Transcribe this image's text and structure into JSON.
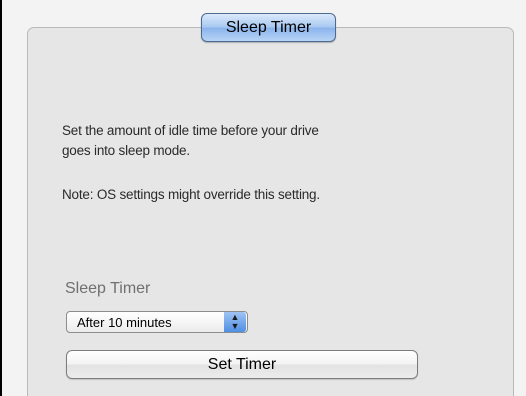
{
  "tab": {
    "label": "Sleep Timer"
  },
  "description": {
    "line1": "Set the amount of idle time before your drive",
    "line2": "goes into sleep mode.",
    "note": "Note: OS settings might override this setting."
  },
  "sleep_timer": {
    "label": "Sleep Timer",
    "selected": "After 10 minutes",
    "arrows_icon": "up-down-arrows-icon"
  },
  "set_button": {
    "label": "Set Timer"
  },
  "colors": {
    "tab_fill": "#a9c9f1",
    "panel_background": "#e6e6e6",
    "select_arrow_fill": "#4f8fe4"
  }
}
